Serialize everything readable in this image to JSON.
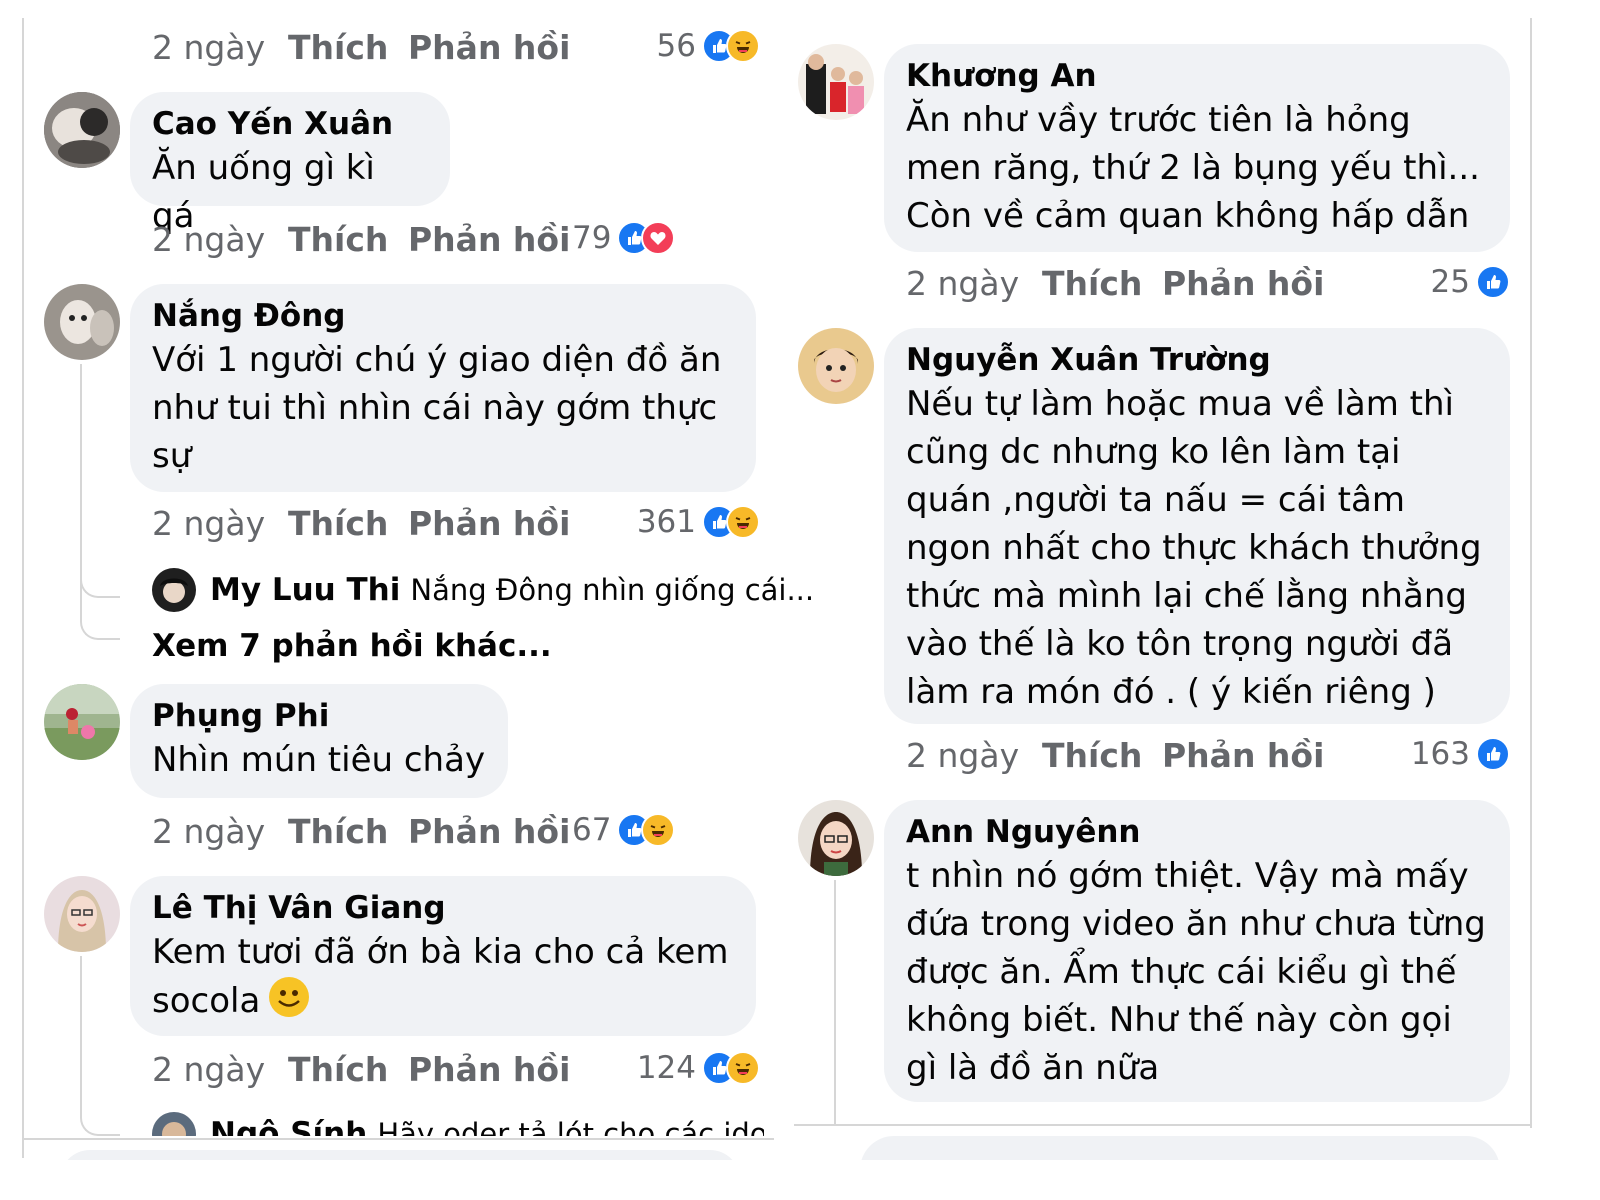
{
  "meta": {
    "time": "2 ngày",
    "like": "Thích",
    "reply": "Phản hồi"
  },
  "left": {
    "top_reactions": "56",
    "comments": [
      {
        "author": "Cao Yến Xuân",
        "text": "Ăn uống gì kì qá",
        "reactions": "79"
      },
      {
        "author": "Nắng Đông",
        "text": "Với 1 người chú ý giao diện đồ ăn như tui thì nhìn cái này gớm thực sự",
        "reactions": "361",
        "reply": {
          "name": "My Luu Thi",
          "text": "Nắng Đông nhìn giống cái..."
        },
        "more": "Xem 7 phản hồi khác..."
      },
      {
        "author": "Phụng Phi",
        "text": "Nhìn mún tiêu chảy",
        "reactions": "67"
      },
      {
        "author": "Lê Thị Vân Giang",
        "text": "Kem tươi đã ớn bà kia cho cả kem socola",
        "reactions": "124",
        "reply": {
          "name": "Ngô Sính",
          "text": "Hãy oder tả lót cho các idol"
        }
      }
    ]
  },
  "right": {
    "comments": [
      {
        "author": "Khương An",
        "text": "Ăn như vầy trước tiên là hỏng men răng, thứ 2 là bụng yếu thì... Còn về cảm quan không hấp dẫn",
        "reactions": "25"
      },
      {
        "author": "Nguyễn Xuân Trường",
        "text": "Nếu tự làm hoặc mua về làm thì cũng dc nhưng ko lên làm tại quán ,người ta nấu = cái tâm ngon nhất cho thực khách thưởng thức mà mình lại chế lằng nhằng vào thế là ko tôn trọng người đã làm ra món đó . ( ý kiến riêng )",
        "reactions": "163"
      },
      {
        "author": "Ann Nguyênn",
        "text": "t nhìn nó gớm thiệt. Vậy mà mấy đứa trong video ăn như chưa từng được ăn. Ẩm thực cái kiểu gì thế không biết. Như thế này còn gọi gì là đồ ăn nữa"
      }
    ]
  },
  "icons": {
    "like": "like-icon",
    "haha": "haha-icon",
    "love": "love-icon",
    "smile": "smile-emoji"
  }
}
